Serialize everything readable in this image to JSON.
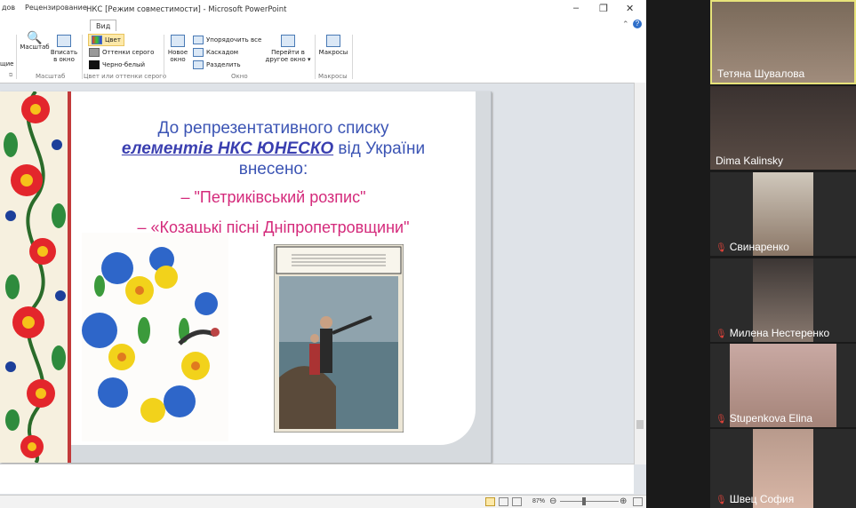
{
  "window": {
    "title": "НКС [Режим совместимости] - Microsoft PowerPoint",
    "tabs": [
      "дов",
      "Рецензирование",
      "Вид"
    ],
    "buttons": {
      "minimize": "–",
      "maximize": "❐",
      "close": "✕"
    }
  },
  "ribbon": {
    "scale_group": {
      "label": "Масштаб",
      "cut_label": "щие",
      "zoom": "Масштаб",
      "fit": [
        "Вписать",
        "в окно"
      ]
    },
    "color_group": {
      "label": "Цвет или оттенки серого",
      "items": [
        "Цвет",
        "Оттенки серого",
        "Черно-белый"
      ]
    },
    "window_group": {
      "label": "Окно",
      "new_window": [
        "Новое",
        "окно"
      ],
      "items": [
        "Упорядочить все",
        "Каскадом",
        "Разделить"
      ],
      "switch": [
        "Перейти в",
        "другое окно ▾"
      ]
    },
    "macros_group": {
      "label": "Макросы",
      "button": "Макросы"
    }
  },
  "slide": {
    "line1": "До репрезентативного списку",
    "line2_link": "елементів НКС ЮНЕСКО",
    "line2_rest": " від України",
    "line3": "внесено:",
    "item1": "–  \"Петриківський розпис\"",
    "item2": "–  «Козацькі пісні Дніпропетровщини\""
  },
  "status": {
    "zoom": "87%"
  },
  "participants": [
    {
      "name": "Тетяна Шувалова",
      "muted": false,
      "active": true
    },
    {
      "name": "Dima Kalinsky",
      "muted": false,
      "active": false
    },
    {
      "name": "Свинаренко",
      "muted": true,
      "active": false
    },
    {
      "name": "Милена Нестеренко",
      "muted": true,
      "active": false
    },
    {
      "name": "Stupenkova Elina",
      "muted": true,
      "active": false
    },
    {
      "name": "Швец София",
      "muted": true,
      "active": false
    }
  ],
  "colors": {
    "accent_blue": "#3a54b5",
    "accent_pink": "#d42a7b",
    "active_border": "#e7e37a"
  }
}
